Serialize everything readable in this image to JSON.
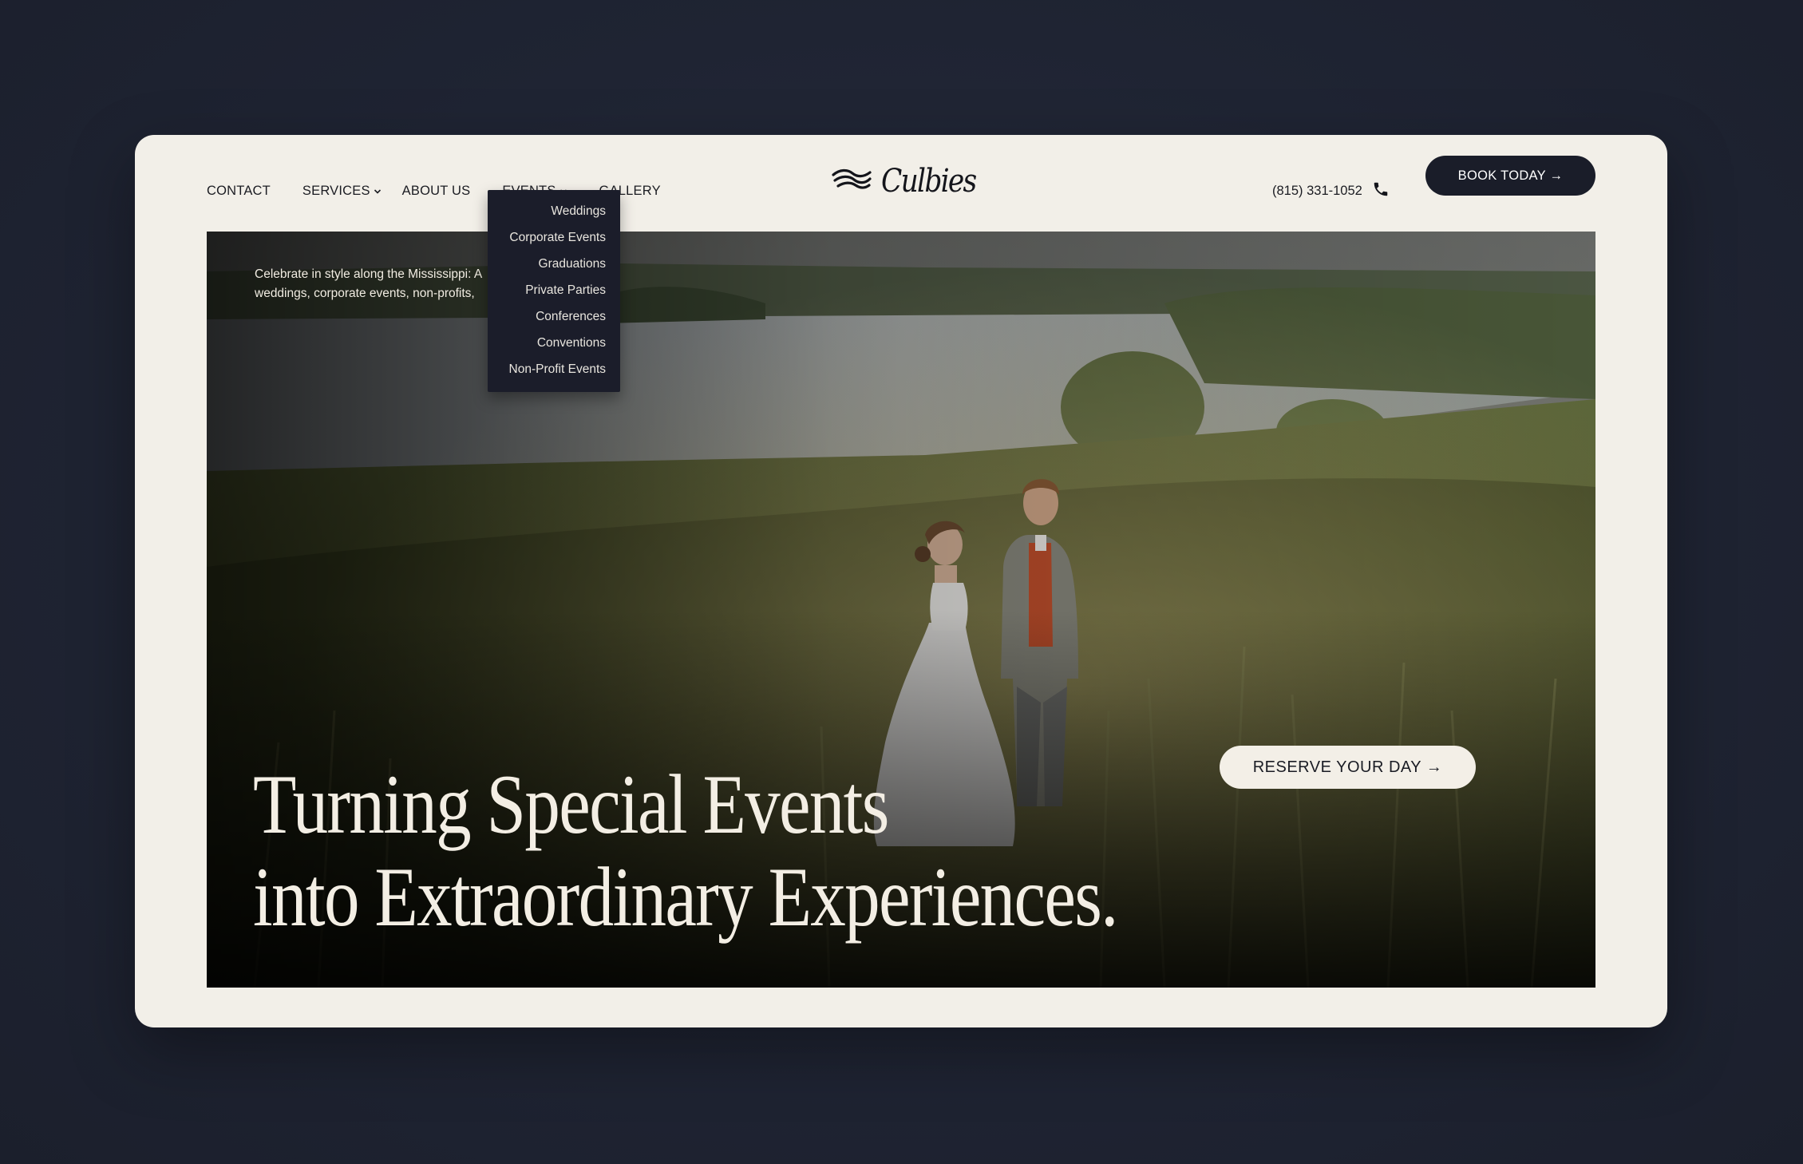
{
  "nav": {
    "items": [
      {
        "label": "CONTACT",
        "has_dropdown": false
      },
      {
        "label": "SERVICES",
        "has_dropdown": true
      },
      {
        "label": "ABOUT US",
        "has_dropdown": false
      },
      {
        "label": "EVENTS",
        "has_dropdown": true
      },
      {
        "label": "GALLERY",
        "has_dropdown": false
      }
    ]
  },
  "brand": {
    "logo_text": "Culbies",
    "logo_icon": "wave-mark-icon"
  },
  "contact": {
    "phone": "(815) 331-1052",
    "phone_icon": "phone-icon"
  },
  "cta": {
    "book_label": "BOOK TODAY →",
    "reserve_label": "RESERVE YOUR DAY →"
  },
  "events_dropdown": {
    "items": [
      "Weddings",
      "Corporate Events",
      "Graduations",
      "Private Parties",
      "Conferences",
      "Conventions",
      "Non-Profit Events"
    ]
  },
  "hero": {
    "intro_line1": "Celebrate in style along the Mississippi: A",
    "intro_line2": "weddings, corporate events, non-profits,",
    "headline_line1": "Turning Special Events",
    "headline_line2": "into Extraordinary Experiences."
  },
  "colors": {
    "page_bg": "#1f2433",
    "card_bg": "#f2efe8",
    "dark_accent": "#1a1d29",
    "light_text": "#f3eee4"
  }
}
